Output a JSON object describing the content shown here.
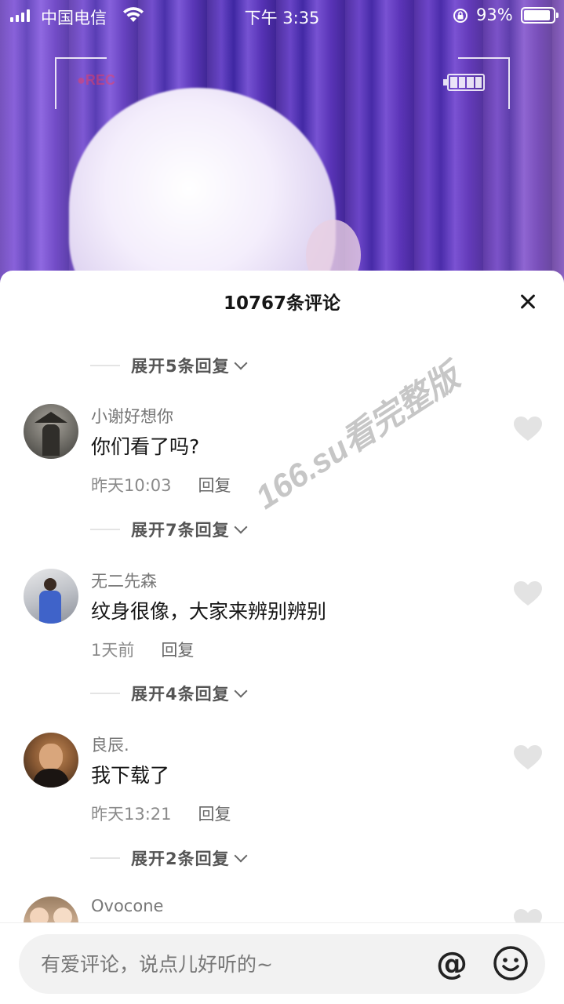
{
  "status_bar": {
    "carrier": "中国电信",
    "time": "下午 3:35",
    "battery_percent": "93%",
    "battery_level": 0.93,
    "signal_bars": 4
  },
  "video": {
    "rec_label": "●REC"
  },
  "comments_panel": {
    "title": "10767条评论",
    "close_icon": "close-icon",
    "items": [
      {
        "type": "expand",
        "label": "展开5条回复"
      },
      {
        "type": "comment",
        "username": "小谢好想你",
        "content": "你们看了吗?",
        "time": "昨天10:03",
        "reply_label": "回复"
      },
      {
        "type": "expand",
        "label": "展开7条回复"
      },
      {
        "type": "comment",
        "username": "无二先森",
        "content": "纹身很像，大家来辨别辨别",
        "time": "1天前",
        "reply_label": "回复"
      },
      {
        "type": "expand",
        "label": "展开4条回复"
      },
      {
        "type": "comment",
        "username": "良辰.",
        "content": "我下载了",
        "time": "昨天13:21",
        "reply_label": "回复"
      },
      {
        "type": "expand",
        "label": "展开2条回复"
      },
      {
        "type": "comment",
        "username": "Ovocone"
      }
    ]
  },
  "watermark": "166.su看完整版",
  "input_bar": {
    "placeholder": "有爱评论，说点儿好听的~",
    "at_label": "@",
    "emoji_icon": "emoji-icon"
  },
  "colors": {
    "accent_text": "#161616",
    "secondary_text": "#8a8a8a",
    "video_purple": "#5533b4"
  }
}
